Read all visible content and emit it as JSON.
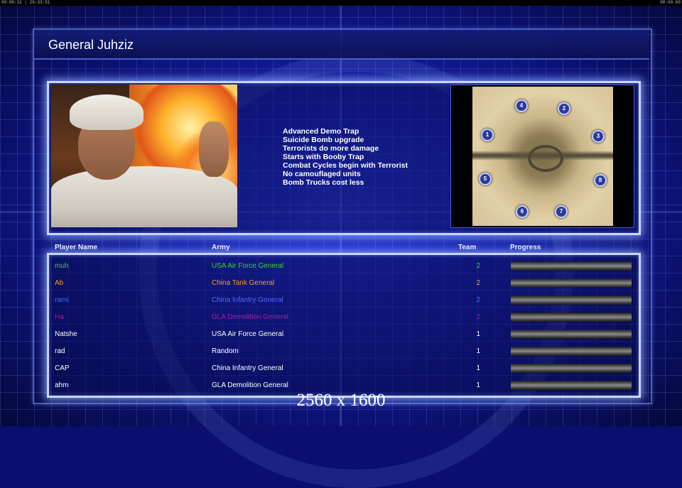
{
  "status_bar": {
    "left_clock": "00:00:32 | 20:33:51",
    "right_clock": "00:00:00"
  },
  "title": "General Juhziz",
  "general_traits": [
    "Advanced Demo Trap",
    "Suicide Bomb upgrade",
    "Terrorists do more damage",
    "Starts with Booby Trap",
    "Combat Cycles begin with Terrorist",
    "No camouflaged units",
    "Bomb Trucks cost less"
  ],
  "map": {
    "start_positions": [
      "1",
      "2",
      "3",
      "4",
      "5",
      "6",
      "7",
      "8"
    ]
  },
  "columns": {
    "player_name": "Player Name",
    "army": "Army",
    "team": "Team",
    "progress": "Progress"
  },
  "players": [
    {
      "name": "muh",
      "army": "USA Air Force General",
      "team": "2",
      "color": "#3fd22a",
      "progress": 0
    },
    {
      "name": "Ab",
      "army": "China Tank General",
      "team": "2",
      "color": "#ff9a1e",
      "progress": 0
    },
    {
      "name": "rami",
      "army": "China Infantry General",
      "team": "2",
      "color": "#4a6cff",
      "progress": 0
    },
    {
      "name": "Ha",
      "army": "GLA Demolition General",
      "team": "2",
      "color": "#b41aa8",
      "progress": 0
    },
    {
      "name": "Natshe",
      "army": "USA Air Force General",
      "team": "1",
      "color": "#ffffff",
      "progress": 0
    },
    {
      "name": "rad",
      "army": "Random",
      "team": "1",
      "color": "#ffffff",
      "progress": 0
    },
    {
      "name": "CAP",
      "army": "China Infantry General",
      "team": "1",
      "color": "#ffffff",
      "progress": 0
    },
    {
      "name": "ahm",
      "army": "GLA Demolition General",
      "team": "1",
      "color": "#ffffff",
      "progress": 0
    }
  ],
  "resolution_text": "2560 x 1600",
  "colors": {
    "background": "#1620a8",
    "panel_border": "#c9d5ff"
  }
}
